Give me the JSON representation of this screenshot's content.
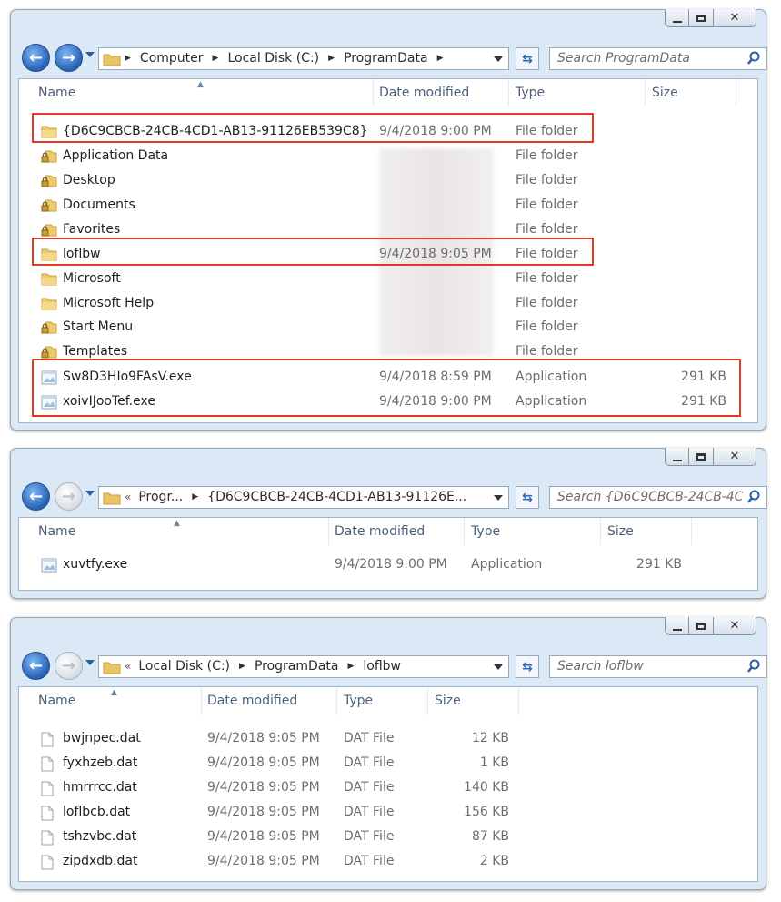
{
  "windows": [
    {
      "breadcrumb": [
        "Computer",
        "Local Disk (C:)",
        "ProgramData"
      ],
      "search_placeholder": "Search ProgramData",
      "columns": [
        "Name",
        "Date modified",
        "Type",
        "Size"
      ],
      "rows": [
        {
          "name": "{D6C9CBCB-24CB-4CD1-AB13-91126EB539C8}",
          "date": "9/4/2018 9:00 PM",
          "type": "File folder",
          "size": "",
          "icon": "folder-icon"
        },
        {
          "name": "Application Data",
          "date": "",
          "type": "File folder",
          "size": "",
          "icon": "locked-folder-icon"
        },
        {
          "name": "Desktop",
          "date": "",
          "type": "File folder",
          "size": "",
          "icon": "locked-folder-icon"
        },
        {
          "name": "Documents",
          "date": "",
          "type": "File folder",
          "size": "",
          "icon": "locked-folder-icon"
        },
        {
          "name": "Favorites",
          "date": "",
          "type": "File folder",
          "size": "",
          "icon": "locked-folder-icon"
        },
        {
          "name": "loflbw",
          "date": "9/4/2018 9:05 PM",
          "type": "File folder",
          "size": "",
          "icon": "folder-icon"
        },
        {
          "name": "Microsoft",
          "date": "",
          "type": "File folder",
          "size": "",
          "icon": "folder-icon"
        },
        {
          "name": "Microsoft Help",
          "date": "",
          "type": "File folder",
          "size": "",
          "icon": "folder-icon"
        },
        {
          "name": "Start Menu",
          "date": "",
          "type": "File folder",
          "size": "",
          "icon": "locked-folder-icon"
        },
        {
          "name": "Templates",
          "date": "",
          "type": "File folder",
          "size": "",
          "icon": "locked-folder-icon"
        },
        {
          "name": "Sw8D3HIo9FAsV.exe",
          "date": "9/4/2018 8:59 PM",
          "type": "Application",
          "size": "291 KB",
          "icon": "application-icon"
        },
        {
          "name": "xoivIJooTef.exe",
          "date": "9/4/2018 9:00 PM",
          "type": "Application",
          "size": "291 KB",
          "icon": "application-icon"
        }
      ]
    },
    {
      "breadcrumb": [
        "Progr...",
        "{D6C9CBCB-24CB-4CD1-AB13-91126E..."
      ],
      "search_placeholder": "Search {D6C9CBCB-24CB-4C...",
      "columns": [
        "Name",
        "Date modified",
        "Type",
        "Size"
      ],
      "rows": [
        {
          "name": "xuvtfy.exe",
          "date": "9/4/2018 9:00 PM",
          "type": "Application",
          "size": "291 KB",
          "icon": "application-icon"
        }
      ]
    },
    {
      "breadcrumb": [
        "Local Disk (C:)",
        "ProgramData",
        "loflbw"
      ],
      "search_placeholder": "Search loflbw",
      "columns": [
        "Name",
        "Date modified",
        "Type",
        "Size"
      ],
      "rows": [
        {
          "name": "bwjnpec.dat",
          "date": "9/4/2018 9:05 PM",
          "type": "DAT File",
          "size": "12 KB",
          "icon": "file-icon"
        },
        {
          "name": "fyxhzeb.dat",
          "date": "9/4/2018 9:05 PM",
          "type": "DAT File",
          "size": "1 KB",
          "icon": "file-icon"
        },
        {
          "name": "hmrrrcc.dat",
          "date": "9/4/2018 9:05 PM",
          "type": "DAT File",
          "size": "140 KB",
          "icon": "file-icon"
        },
        {
          "name": "loflbcb.dat",
          "date": "9/4/2018 9:05 PM",
          "type": "DAT File",
          "size": "156 KB",
          "icon": "file-icon"
        },
        {
          "name": "tshzvbc.dat",
          "date": "9/4/2018 9:05 PM",
          "type": "DAT File",
          "size": "87 KB",
          "icon": "file-icon"
        },
        {
          "name": "zipdxdb.dat",
          "date": "9/4/2018 9:05 PM",
          "type": "DAT File",
          "size": "2 KB",
          "icon": "file-icon"
        }
      ]
    }
  ],
  "colors": {
    "highlight": "#e03a22",
    "header_text": "#4c607a",
    "secondary_text": "#6d6d6d",
    "window_frame": "#dbe8f5"
  }
}
